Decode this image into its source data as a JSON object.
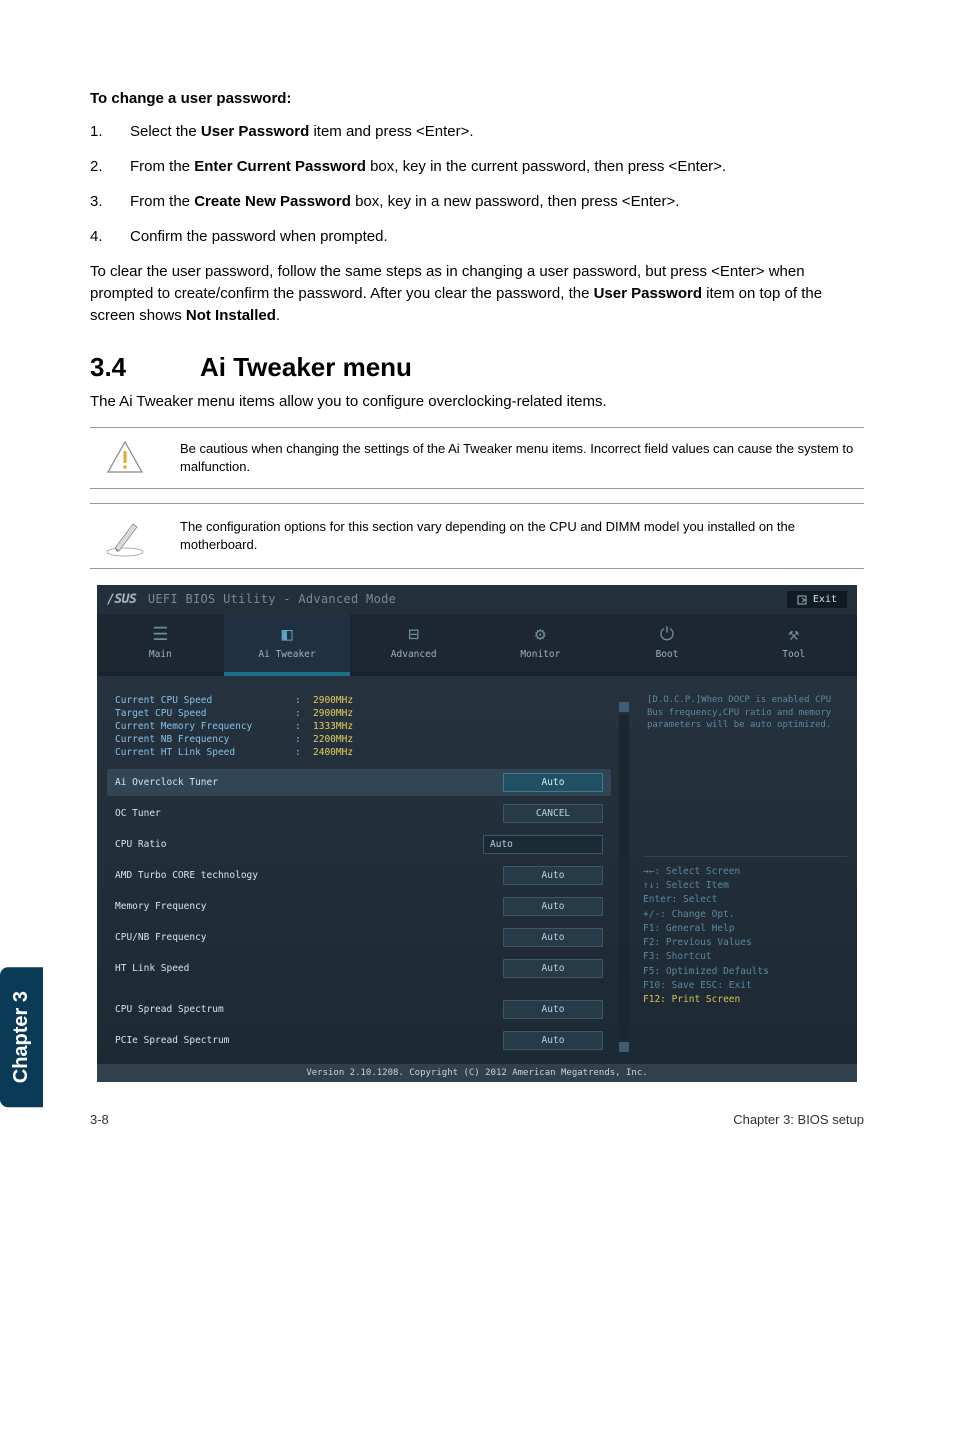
{
  "doc": {
    "heading": "To change a user password:",
    "steps": [
      {
        "num": "1.",
        "html": "Select the <b>User Password</b> item and press <Enter>."
      },
      {
        "num": "2.",
        "html": "From the <b>Enter Current Password</b> box, key in the current password, then press <Enter>."
      },
      {
        "num": "3.",
        "html": "From the <b>Create New Password</b> box, key in a new password, then press <Enter>."
      },
      {
        "num": "4.",
        "html": "Confirm the password when prompted."
      }
    ],
    "clear_para": "To clear the user password, follow the same steps as in changing a user password, but press <Enter> when prompted to create/confirm the password. After you clear the password, the <b>User Password</b> item on top of the screen shows <b>Not Installed</b>.",
    "section_num": "3.4",
    "section_title": "Ai Tweaker menu",
    "section_desc": "The Ai Tweaker menu items allow you to configure overclocking-related items.",
    "callout1": "Be cautious when changing the settings of the Ai Tweaker menu items. Incorrect field values can cause the system to malfunction.",
    "callout2": "The configuration options for this section vary depending on the CPU and DIMM model you installed on the motherboard.",
    "side_tab": "Chapter 3",
    "footer_left": "3-8",
    "footer_right": "Chapter 3: BIOS setup"
  },
  "bios": {
    "title_brand": "/SUS",
    "title_rest": " UEFI BIOS Utility - Advanced Mode",
    "exit": "Exit",
    "tabs": [
      "Main",
      "Ai Tweaker",
      "Advanced",
      "Monitor",
      "Boot",
      "Tool"
    ],
    "active_tab": 1,
    "info": [
      {
        "label": "Current CPU Speed",
        "val": "2900MHz"
      },
      {
        "label": "Target CPU Speed",
        "val": "2900MHz"
      },
      {
        "label": "Current Memory Frequency",
        "val": "1333MHz"
      },
      {
        "label": "Current NB Frequency",
        "val": "2200MHz"
      },
      {
        "label": "Current HT Link Speed",
        "val": "2400MHz"
      }
    ],
    "settings": [
      {
        "label": "Ai Overclock Tuner",
        "val": "Auto",
        "highlight": true,
        "pill": true,
        "editable": true
      },
      {
        "label": "OC Tuner",
        "val": "CANCEL",
        "pill": true
      },
      {
        "label": "CPU Ratio",
        "val": "Auto",
        "input": true
      },
      {
        "label": "AMD Turbo CORE technology",
        "val": "Auto",
        "pill": true
      },
      {
        "label": "Memory Frequency",
        "val": "Auto",
        "pill": true
      },
      {
        "label": "CPU/NB Frequency",
        "val": "Auto",
        "pill": true
      },
      {
        "label": "HT Link Speed",
        "val": "Auto",
        "pill": true
      },
      {
        "label": "CPU Spread Spectrum",
        "val": "Auto",
        "pill": true
      },
      {
        "label": "PCIe Spread Spectrum",
        "val": "Auto",
        "pill": true
      }
    ],
    "help_text": "[D.O.C.P.]When DOCP is enabled CPU Bus frequency,CPU ratio and memory parameters will be auto optimized.",
    "key_help": [
      "→←: Select Screen",
      "↑↓: Select Item",
      "Enter: Select",
      "+/-: Change Opt.",
      "F1: General Help",
      "F2: Previous Values",
      "F3: Shortcut",
      "F5: Optimized Defaults",
      "F10: Save  ESC: Exit",
      "F12: Print Screen"
    ],
    "footer": "Version 2.10.1208. Copyright (C) 2012 American Megatrends, Inc."
  }
}
